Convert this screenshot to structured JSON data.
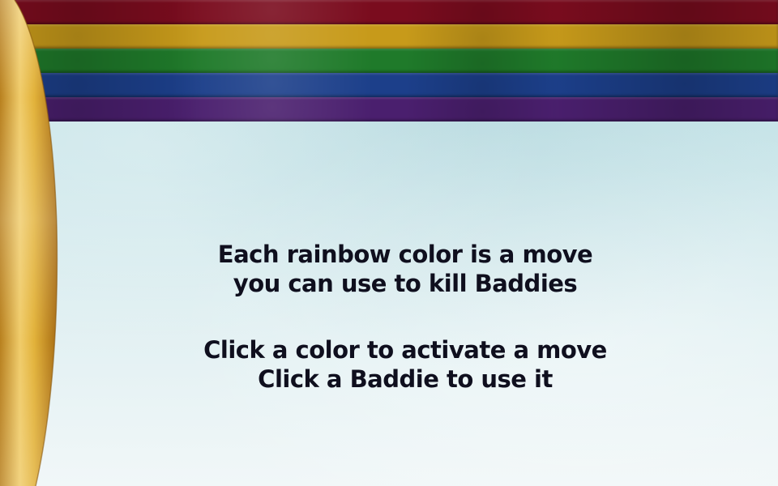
{
  "rainbow": {
    "colors": [
      "#7a0c1e",
      "#c79a1a",
      "#1f7a2a",
      "#1c3f8a",
      "#4a1f6e"
    ]
  },
  "scroll": {
    "color": "#e2b23a"
  },
  "instructions": {
    "block_1": {
      "line_1": "Each rainbow color is a move",
      "line_2": "you can use to kill Baddies"
    },
    "block_2": {
      "line_1": "Click a color to activate a move",
      "line_2": "Click a Baddie to use it"
    }
  }
}
